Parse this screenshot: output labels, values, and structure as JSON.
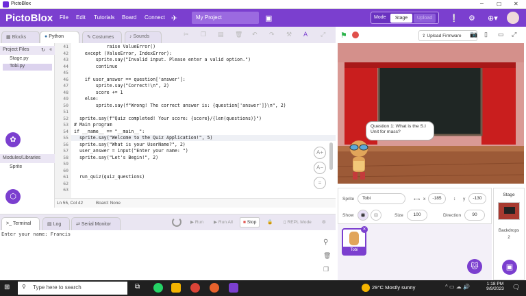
{
  "window": {
    "title": "PictoBlox",
    "controls": [
      "−",
      "▢",
      "✕"
    ]
  },
  "menubar": {
    "logo": "PictoBlox",
    "items": [
      "File",
      "Edit",
      "Tutorials",
      "Board",
      "Connect"
    ],
    "project_name": "My Project",
    "mode_label": "Mode",
    "stage_label": "Stage",
    "upload_label": "Upload"
  },
  "tabs": {
    "blocks": "Blocks",
    "python": "Python",
    "costumes": "Costumes",
    "sounds": "Sounds"
  },
  "left": {
    "project_files": "Project Files",
    "files": [
      "Stage.py",
      "Tobi.py"
    ],
    "modules": "Modules/Libraries",
    "module_items": [
      "Sprite"
    ]
  },
  "editor": {
    "lines": [
      {
        "n": "41",
        "t": "            raise ValueError()"
      },
      {
        "n": "42",
        "t": "    except (ValueError, IndexError):"
      },
      {
        "n": "43",
        "t": "        sprite.say(\"Invalid input. Please enter a valid option.\")"
      },
      {
        "n": "44",
        "t": "        continue"
      },
      {
        "n": "45",
        "t": ""
      },
      {
        "n": "46",
        "t": "    if user_answer == question['answer']:"
      },
      {
        "n": "47",
        "t": "        sprite.say(\"Correct!\\n\", 2)"
      },
      {
        "n": "48",
        "t": "        score += 1"
      },
      {
        "n": "49",
        "t": "    else:"
      },
      {
        "n": "50",
        "t": "        sprite.say(f\"Wrong! The correct answer is: {question['answer']}\\n\", 2)"
      },
      {
        "n": "51",
        "t": ""
      },
      {
        "n": "52",
        "t": "  sprite.say(f\"Quiz completed! Your score: {score}/{len(questions)}\")"
      },
      {
        "n": "53",
        "t": "# Main program"
      },
      {
        "n": "54",
        "t": "if __name__ == \"__main__\":"
      },
      {
        "n": "55",
        "t": "  sprite.say(\"Welcome to the Quiz Application!\", 5)"
      },
      {
        "n": "56",
        "t": "  sprite.say(\"What is your UserName?\", 2)"
      },
      {
        "n": "57",
        "t": "  user_answer = input(\"Enter your name: \")"
      },
      {
        "n": "58",
        "t": "  sprite.say(\"Let's Begin!\", 2)"
      },
      {
        "n": "59",
        "t": ""
      },
      {
        "n": "60",
        "t": ""
      },
      {
        "n": "61",
        "t": "  run_quiz(quiz_questions)"
      },
      {
        "n": "62",
        "t": ""
      },
      {
        "n": "63",
        "t": ""
      }
    ],
    "status_position": "Ln 55, Col 42",
    "status_board": "Board: None"
  },
  "terminal": {
    "tabs": [
      "Terminal",
      "Log",
      "Serial Monitor"
    ],
    "run": "Run",
    "run_all": "Run All",
    "stop": "Stop",
    "repl": "REPL Mode",
    "output": "Enter your name: Francis"
  },
  "stage": {
    "upload_firmware": "Upload Firmware",
    "bubble": "Question 1: What is the S.I Unit for mass?"
  },
  "sprite": {
    "sprite_label": "Sprite",
    "name": "Tobi",
    "x_label": "x",
    "x": "-185",
    "y_label": "y",
    "y": "-130",
    "show_label": "Show",
    "size_label": "Size",
    "size": "100",
    "direction_label": "Direction",
    "direction": "90",
    "thumb_name": "Tobi"
  },
  "stagepanel": {
    "title": "Stage",
    "backdrops_label": "Backdrops",
    "backdrops_count": "2"
  },
  "taskbar": {
    "search": "Type here to search",
    "weather": "29°C  Mostly sunny",
    "time": "1:18 PM",
    "date": "9/9/2023"
  },
  "colors": {
    "brand": "#7b3fcf",
    "stop": "#e0504b",
    "flag": "#2bb34a"
  }
}
